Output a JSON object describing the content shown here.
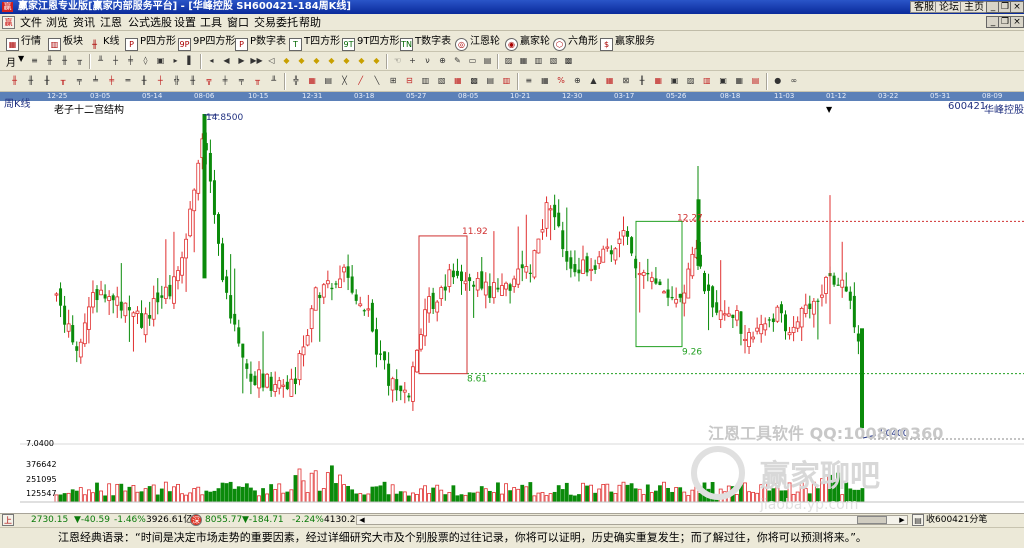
{
  "window": {
    "title": "赢家江恩专业版[赢家内部服务平台] - [华峰控股  SH600421-184周K线]",
    "links": [
      "客服",
      "论坛",
      "主页"
    ],
    "controls": [
      "_",
      "❐",
      "×"
    ]
  },
  "menu": [
    "文件",
    "浏览",
    "资讯",
    "江恩",
    "公式选股",
    "设置",
    "工具",
    "窗口",
    "交易委托",
    "帮助"
  ],
  "toolbar1": [
    "行情",
    "板块",
    "K线",
    "P四方形",
    "9P四方形",
    "P数字表",
    "T四方形",
    "9T四方形",
    "T数字表",
    "江恩轮",
    "赢家轮",
    "六角形",
    "赢家服务"
  ],
  "toolbar2": {
    "period": "月"
  },
  "date_ticks": [
    "12-25",
    "03-05",
    "05-14",
    "08-06",
    "10-15",
    "12-31",
    "03-18",
    "05-27",
    "08-05",
    "10-21",
    "12-30",
    "03-17",
    "05-26",
    "08-18",
    "11-03",
    "01-12",
    "03-22",
    "05-31",
    "08-09"
  ],
  "chart": {
    "period_label": "周K线",
    "indicator_label": "老子十二宫结构",
    "stock_code": "600421",
    "stock_name": "华峰控股",
    "high_label": "14.8500",
    "low_label": "7.0400",
    "box_labels": [
      "11.92",
      "8.61",
      "12.27",
      "9.26"
    ],
    "watermark": "江恩工具软件  QQ:100800360",
    "watermark2": "赢家聊吧",
    "watermark3": "jiaoba.yp.com",
    "volume_axis": [
      "7.0400",
      "376642",
      "251095",
      "125547"
    ],
    "colors": {
      "up": "#e03030",
      "down": "#0a8a0a",
      "grid": "#c0c0c0"
    }
  },
  "status": {
    "sh_index": "2730.15",
    "sh_change": "▼-40.59",
    "sh_pct": "-1.46%",
    "sh_vol": "3926.61亿",
    "sz_index": "8055.77",
    "sz_change": "▼-184.71",
    "sz_pct": "-2.24%",
    "sz_vol": "4130.2",
    "right": "收600421分笔"
  },
  "quote": "江恩经典语录：“时间是决定市场走势的重要因素，经过详细研究大市及个别股票的过往记录，你将可以证明，历史确实重复发生；而了解过往，你将可以预测将来。”。"
}
